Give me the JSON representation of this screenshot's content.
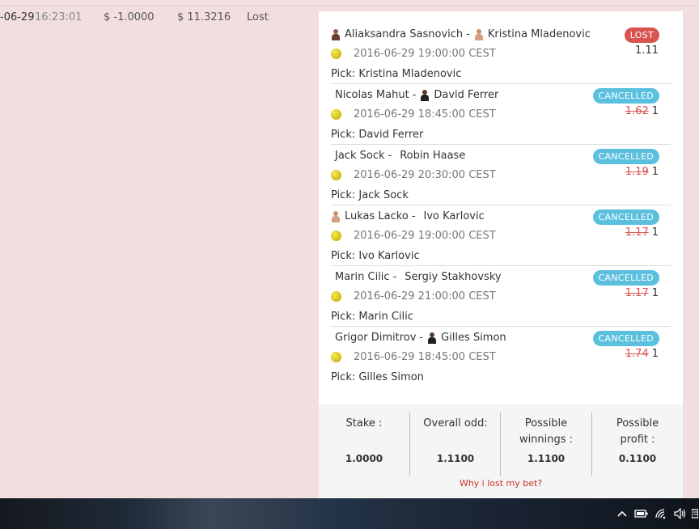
{
  "history_row": {
    "date": "-06-29",
    "time": "16:23:01",
    "stake": "$ -1.0000",
    "winnings": "$ 11.3216",
    "status": "Lost"
  },
  "bets": [
    {
      "player1": "Aliaksandra Sasnovich",
      "player1_avatar": true,
      "player2": "Kristina Mladenovic",
      "player2_avatar": true,
      "datetime": "2016-06-29 19:00:00 CEST",
      "pick": "Pick: Kristina Mladenovic",
      "status": "LOST",
      "status_type": "lost",
      "odd_struck": "",
      "odd": "1.11"
    },
    {
      "player1": "Nicolas Mahut",
      "player1_avatar": false,
      "player2": "David Ferrer",
      "player2_avatar": true,
      "datetime": "2016-06-29 18:45:00 CEST",
      "pick": "Pick: David Ferrer",
      "status": "CANCELLED",
      "status_type": "cancelled",
      "odd_struck": "1.62",
      "odd": "1"
    },
    {
      "player1": "Jack Sock",
      "player1_avatar": false,
      "player2": "Robin Haase",
      "player2_avatar": false,
      "datetime": "2016-06-29 20:30:00 CEST",
      "pick": "Pick: Jack Sock",
      "status": "CANCELLED",
      "status_type": "cancelled",
      "odd_struck": "1.19",
      "odd": "1"
    },
    {
      "player1": "Lukas Lacko",
      "player1_avatar": true,
      "player2": "Ivo Karlovic",
      "player2_avatar": false,
      "datetime": "2016-06-29 19:00:00 CEST",
      "pick": "Pick: Ivo Karlovic",
      "status": "CANCELLED",
      "status_type": "cancelled",
      "odd_struck": "1.17",
      "odd": "1"
    },
    {
      "player1": "Marin Cilic",
      "player1_avatar": false,
      "player2": "Sergiy Stakhovsky",
      "player2_avatar": false,
      "datetime": "2016-06-29 21:00:00 CEST",
      "pick": "Pick: Marin Cilic",
      "status": "CANCELLED",
      "status_type": "cancelled",
      "odd_struck": "1.17",
      "odd": "1"
    },
    {
      "player1": "Grigor Dimitrov",
      "player1_avatar": false,
      "player2": "Gilles Simon",
      "player2_avatar": true,
      "datetime": "2016-06-29 18:45:00 CEST",
      "pick": "Pick: Gilles Simon",
      "status": "CANCELLED",
      "status_type": "cancelled",
      "odd_struck": "1.74",
      "odd": "1"
    }
  ],
  "summary": {
    "stake_label": "Stake :",
    "stake_value": "1.0000",
    "overall_odd_label": "Overall odd:",
    "overall_odd_value": "1.1100",
    "possible_winnings_label": "Possible winnings :",
    "possible_winnings_value": "1.1100",
    "possible_profit_label": "Possible profit :",
    "possible_profit_value": "0.1100",
    "why_lost_link": "Why i lost my bet?"
  },
  "colors": {
    "page_background": "#f2dede",
    "lost_badge": "#d9534f",
    "cancelled_badge": "#5bc0de",
    "link": "#c9302c"
  },
  "tray_icons": [
    "chevron-up-icon",
    "battery-icon",
    "wifi-icon",
    "volume-icon",
    "notification-icon"
  ]
}
